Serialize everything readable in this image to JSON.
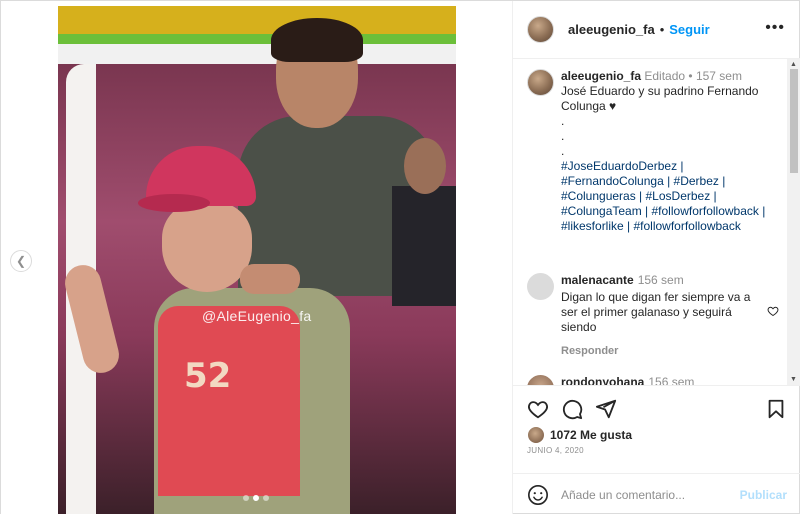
{
  "post": {
    "author": "aleeugenio_fa",
    "follow_label": "Seguir",
    "separator": "•",
    "more_label": "•••",
    "watermark": "@AleEugenio_fa",
    "shirt_number": "52",
    "carousel": {
      "slides": 3,
      "active_index": 1
    }
  },
  "caption": {
    "username": "aleeugenio_fa",
    "edited": "Editado",
    "time": "157 sem",
    "text": "José Eduardo y su padrino Fernando Colunga ♥",
    "dots": [
      ".",
      ".",
      "."
    ],
    "hashtags_line1": "#JoseEduardoDerbez |",
    "hashtags_line2": "#FernandoColunga | #Derbez |",
    "hashtags_line3": "#Colungueras | #LosDerbez |",
    "hashtags_line4": "#ColungaTeam | #followforfollowback |",
    "hashtags_line5": "#likesforlike | #followforfollowback"
  },
  "comments": [
    {
      "username": "malenacante",
      "time": "156 sem",
      "text": "Digan lo que digan fer siempre va a ser el primer galanaso y seguirá siendo",
      "reply_label": "Responder"
    },
    {
      "username": "rondonyohana",
      "time": "156 sem"
    }
  ],
  "likes": {
    "count_label": "1072 Me gusta"
  },
  "date": "JUNIO 4, 2020",
  "comment_box": {
    "placeholder": "Añade un comentario...",
    "publish_label": "Publicar"
  },
  "icons": {
    "like": "heart-icon",
    "comment": "comment-icon",
    "share": "send-icon",
    "save": "bookmark-icon",
    "emoji": "emoji-icon",
    "prev": "chevron-left-icon"
  },
  "colors": {
    "accent": "#0095f6",
    "link": "#00376b",
    "muted": "#8e8e8e",
    "publish_disabled": "#b2dffc"
  }
}
